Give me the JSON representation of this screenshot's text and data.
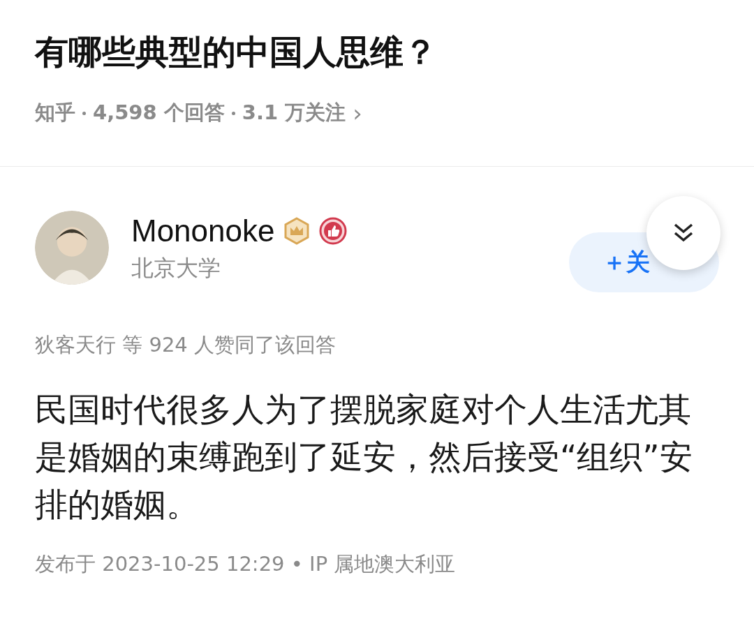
{
  "question": {
    "title": "有哪些典型的中国人思维？",
    "meta": [
      "知乎",
      "4,598 个回答",
      "3.1 万关注"
    ],
    "more": "›"
  },
  "author": {
    "name": "Mononoke",
    "school": "北京大学",
    "follow_label": "＋关"
  },
  "voters": "狄客天行 等 924 人赞同了该回答",
  "answer": "民国时代很多人为了摆脱家庭对个人生活尤其是婚姻的束缚跑到了延安，然后接受“组织”安排的婚姻。",
  "footer": "发布于 2023-10-25 12:29 • IP 属地澳大利亚"
}
